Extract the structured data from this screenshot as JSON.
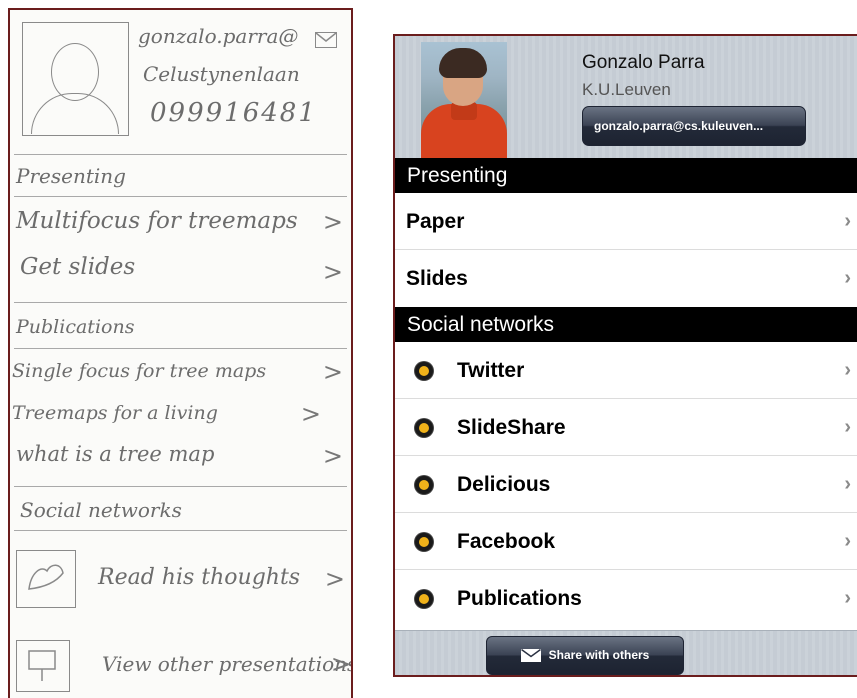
{
  "sketch": {
    "email": "gonzalo.parra@",
    "organization": "Celustynenlaan",
    "phone": "099916481",
    "presenting_header": "Presenting",
    "presenting_items": [
      {
        "label": "Multifocus for treemaps",
        "chevron": ">"
      },
      {
        "label": "Get slides",
        "chevron": ">"
      }
    ],
    "publications_header": "Publications",
    "publications_items": [
      {
        "label": "Single focus for tree maps",
        "chevron": ">"
      },
      {
        "label": "Treemaps for a living",
        "chevron": ">"
      },
      {
        "label": "what is a tree map",
        "chevron": ">"
      }
    ],
    "social_header": "Social networks",
    "social_items": [
      {
        "label": "Read his thoughts",
        "chevron": ">"
      },
      {
        "label": "View other presentations",
        "chevron": ">"
      }
    ]
  },
  "app": {
    "profile": {
      "name": "Gonzalo Parra",
      "affiliation": "K.U.Leuven",
      "email_button": "gonzalo.parra@cs.kuleuven..."
    },
    "presenting": {
      "header": "Presenting",
      "items": [
        {
          "label": "Paper",
          "chevron": "›"
        },
        {
          "label": "Slides",
          "chevron": "›"
        }
      ]
    },
    "social": {
      "header": "Social networks",
      "items": [
        {
          "label": "Twitter",
          "icon": "twitter-icon",
          "chevron": "›"
        },
        {
          "label": "SlideShare",
          "icon": "slideshare-icon",
          "chevron": "›"
        },
        {
          "label": "Delicious",
          "icon": "delicious-icon",
          "chevron": "›"
        },
        {
          "label": "Facebook",
          "icon": "facebook-icon",
          "chevron": "›"
        },
        {
          "label": "Publications",
          "icon": "publications-icon",
          "chevron": "›"
        }
      ]
    },
    "footer": {
      "share_button": "Share with others"
    },
    "colors": {
      "section_bg": "#000000",
      "header_bg": "#c5ccd4",
      "button_dark": "#232a39",
      "icon_accent": "#f0b21a",
      "frame_border": "#6b1d1d"
    }
  }
}
